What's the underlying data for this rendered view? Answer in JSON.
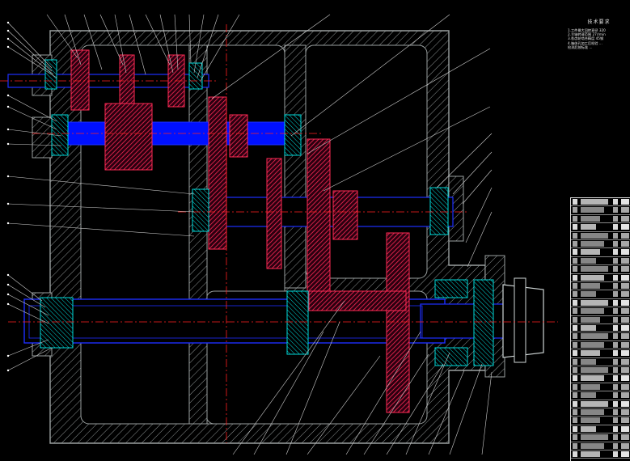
{
  "notes": {
    "title": "技术要求",
    "lines": [
      "1.工件最大回转直径 320",
      "2.主轴转速范围 27r/min",
      "3.各齿轮啮合精度 45钢",
      "4.箱体孔加工后检验 ...",
      "   检测后按标准 ..."
    ]
  },
  "colors": {
    "background": "#000000",
    "housing": "#9aa0a0",
    "housing_hatch": "#9aa0a0",
    "gear_fill": "#e4003c",
    "shaft": "#1d2fff",
    "bearing": "#00e5e5",
    "center_line": "#ff2020",
    "leader": "#cccccc",
    "text": "#ffffff"
  },
  "bom": {
    "row_count": 31
  }
}
